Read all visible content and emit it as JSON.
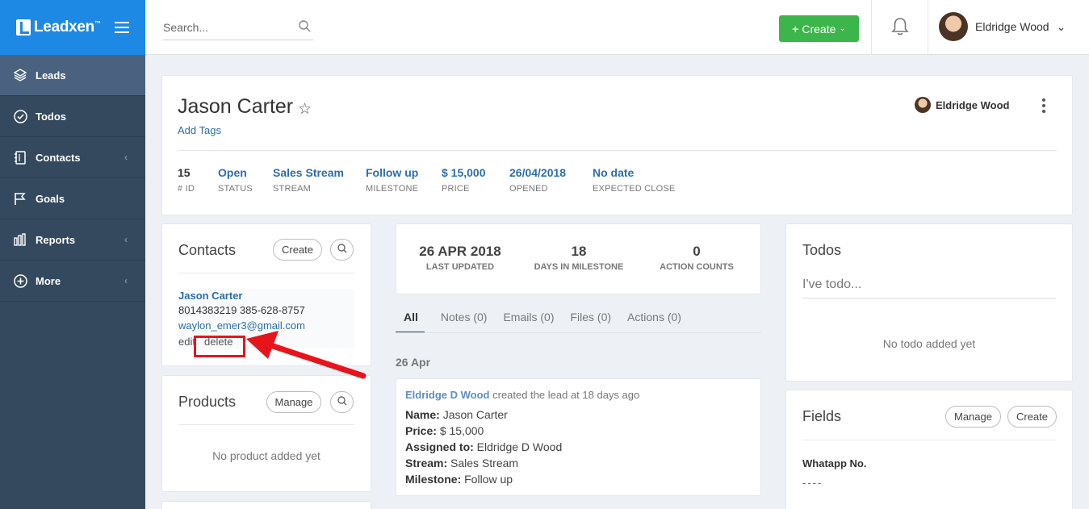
{
  "app": {
    "brand": "Leadxen",
    "brand_tm": "™"
  },
  "sidebar": {
    "items": [
      {
        "label": "Leads",
        "icon": "layers-icon",
        "active": true,
        "has_chevron": false
      },
      {
        "label": "Todos",
        "icon": "check-circle-icon",
        "active": false,
        "has_chevron": false
      },
      {
        "label": "Contacts",
        "icon": "address-book-icon",
        "active": false,
        "has_chevron": true
      },
      {
        "label": "Goals",
        "icon": "flag-icon",
        "active": false,
        "has_chevron": false
      },
      {
        "label": "Reports",
        "icon": "bar-chart-icon",
        "active": false,
        "has_chevron": true
      },
      {
        "label": "More",
        "icon": "plus-circle-icon",
        "active": false,
        "has_chevron": true
      }
    ]
  },
  "topbar": {
    "search_placeholder": "Search...",
    "create_label": "Create",
    "user_name": "Eldridge Wood"
  },
  "lead": {
    "name": "Jason Carter",
    "add_tags": "Add Tags",
    "owner": "Eldridge Wood",
    "stats": [
      {
        "value": "15",
        "label": "# ID"
      },
      {
        "value": "Open",
        "label": "STATUS"
      },
      {
        "value": "Sales Stream",
        "label": "STREAM"
      },
      {
        "value": "Follow up",
        "label": "MILESTONE"
      },
      {
        "value": "$ 15,000",
        "label": "PRICE"
      },
      {
        "value": "26/04/2018",
        "label": "OPENED"
      },
      {
        "value": "No date",
        "label": "EXPECTED CLOSE"
      }
    ]
  },
  "contacts": {
    "title": "Contacts",
    "create_label": "Create",
    "contact": {
      "name": "Jason Carter",
      "phones": "8014383219 385-628-8757",
      "email": "waylon_emer3@gmail.com",
      "edit_label": "edit",
      "delete_label": "delete"
    }
  },
  "products": {
    "title": "Products",
    "manage_label": "Manage",
    "empty": "No product added yet"
  },
  "summary": [
    {
      "value": "26 APR 2018",
      "label": "LAST UPDATED"
    },
    {
      "value": "18",
      "label": "DAYS IN MILESTONE"
    },
    {
      "value": "0",
      "label": "ACTION COUNTS"
    }
  ],
  "tabs": [
    {
      "label": "All",
      "active": true
    },
    {
      "label": "Notes (0)",
      "active": false
    },
    {
      "label": "Emails (0)",
      "active": false
    },
    {
      "label": "Files (0)",
      "active": false
    },
    {
      "label": "Actions (0)",
      "active": false
    }
  ],
  "activity": {
    "date": "26 Apr",
    "actor": "Eldridge D Wood",
    "action": "created the lead at 18 days ago",
    "lines": [
      {
        "key": "Name:",
        "value": "Jason Carter"
      },
      {
        "key": "Price:",
        "value": "$ 15,000"
      },
      {
        "key": "Assigned to:",
        "value": "Eldridge D Wood"
      },
      {
        "key": "Stream:",
        "value": "Sales Stream"
      },
      {
        "key": "Milestone:",
        "value": "Follow up"
      }
    ]
  },
  "todos": {
    "title": "Todos",
    "placeholder": "I've todo...",
    "empty": "No todo added yet"
  },
  "fields": {
    "title": "Fields",
    "manage_label": "Manage",
    "create_label": "Create",
    "field_label": "Whatapp No.",
    "field_value": "----"
  },
  "colors": {
    "sidebar": "#34495e",
    "brand": "#1e88e5",
    "create_button": "#3cb64a",
    "link": "#2c6eab",
    "annotation": "#e8141c"
  }
}
